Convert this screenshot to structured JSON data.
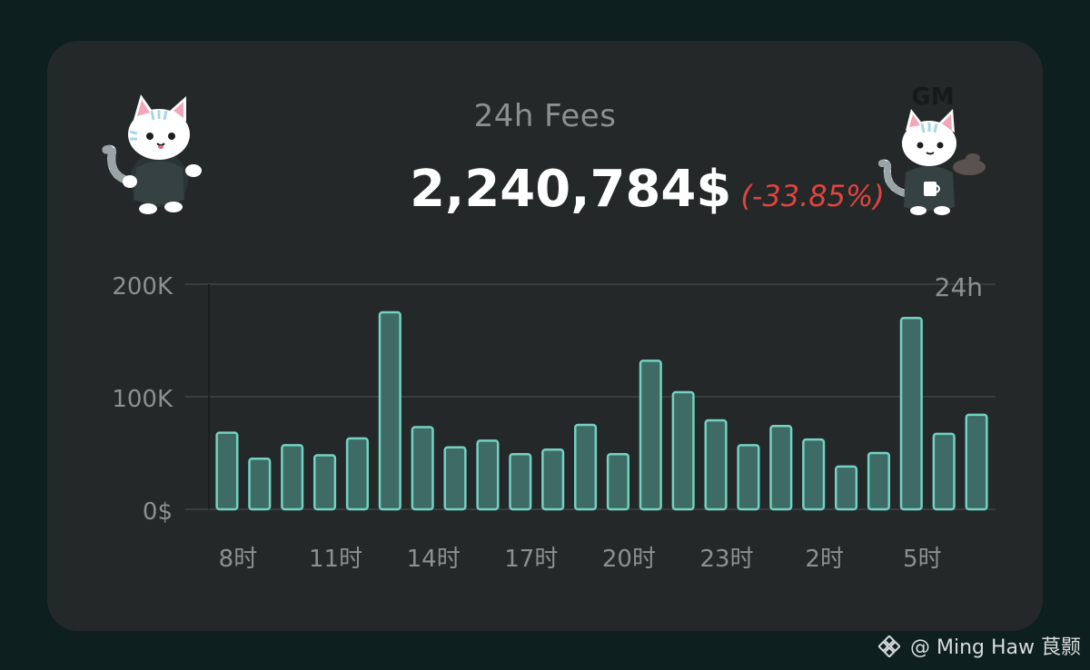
{
  "header": {
    "title": "24h Fees",
    "amount": "2,240,784$",
    "change": "(-33.85%)"
  },
  "decorations": {
    "left_cat": "cat-mascot-hoodie",
    "right_cat": "cat-mascot-coffee",
    "right_cat_text": "GM"
  },
  "watermark": {
    "icon": "binance-icon",
    "text": "@ Ming Haw 茛颢"
  },
  "colors": {
    "background": "#0d1f1e",
    "card": "#252828",
    "bar_fill": "#3e6b65",
    "bar_stroke": "#72d2c3",
    "grid": "#393d3d",
    "axis_text": "#8b9090",
    "negative": "#e0443e"
  },
  "chart_data": {
    "type": "bar",
    "legend_text": "24h",
    "y_ticks": [
      "200K",
      "100K",
      "0$"
    ],
    "ylim": [
      0,
      200000
    ],
    "x_tick_labels": [
      "8时",
      "11时",
      "14时",
      "17时",
      "20时",
      "23时",
      "2时",
      "5时"
    ],
    "x_tick_positions": [
      0,
      3,
      6,
      9,
      12,
      15,
      18,
      21
    ],
    "values": [
      68000,
      45000,
      57000,
      48000,
      63000,
      175000,
      73000,
      55000,
      61000,
      49000,
      53000,
      75000,
      49000,
      132000,
      104000,
      79000,
      57000,
      74000,
      62000,
      38000,
      50000,
      170000,
      67000,
      84000
    ],
    "grid": true
  }
}
